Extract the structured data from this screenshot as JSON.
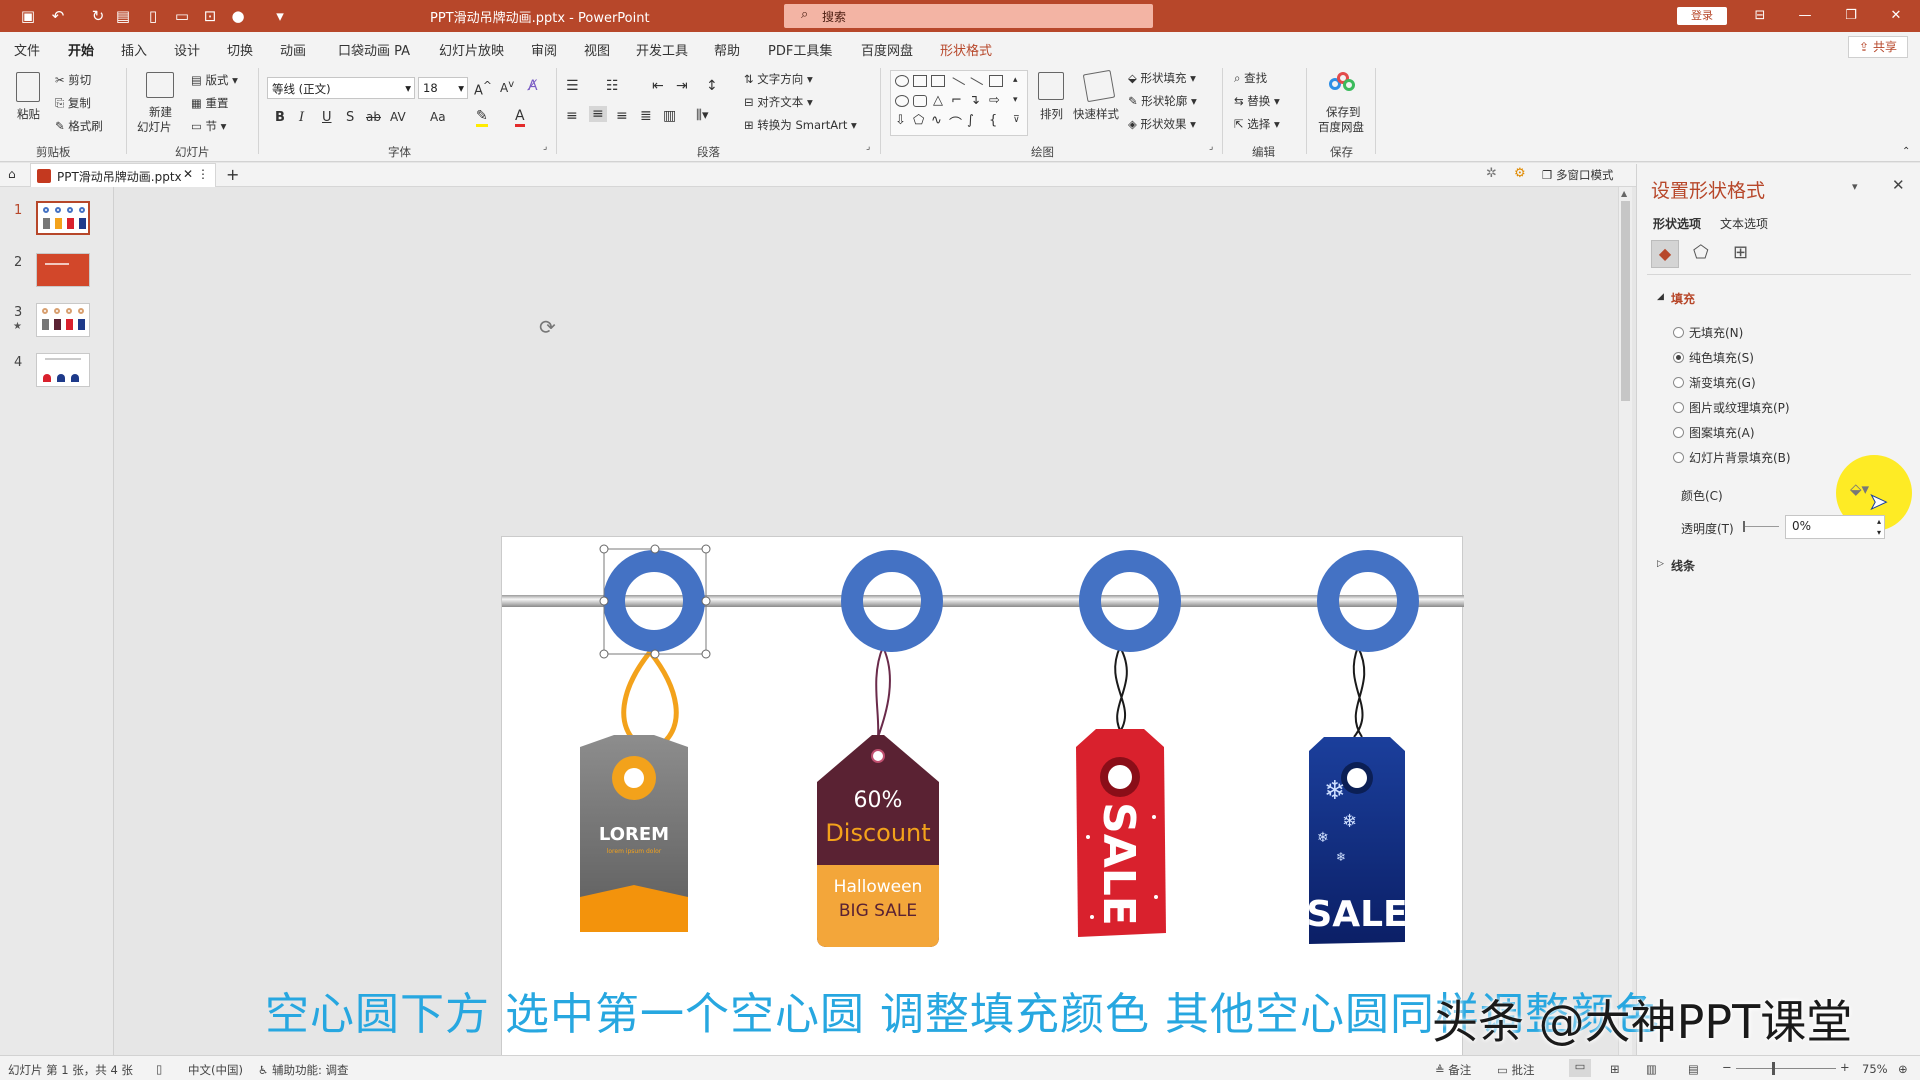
{
  "window": {
    "title": "PPT滑动吊牌动画.pptx - PowerPoint",
    "search_placeholder": "搜索",
    "login": "登录",
    "share": "共享"
  },
  "menu_tabs": [
    "文件",
    "开始",
    "插入",
    "设计",
    "切换",
    "动画",
    "口袋动画 PA",
    "幻灯片放映",
    "审阅",
    "视图",
    "开发工具",
    "帮助",
    "PDF工具集",
    "百度网盘",
    "形状格式"
  ],
  "active_tab": "开始",
  "ribbon": {
    "clipboard": {
      "paste": "粘贴",
      "cut": "剪切",
      "copy": "复制",
      "format_painter": "格式刷",
      "label": "剪贴板"
    },
    "slides": {
      "new_slide": "新建",
      "new_slide2": "幻灯片",
      "layout": "版式",
      "reset": "重置",
      "section": "节",
      "label": "幻灯片"
    },
    "font": {
      "name": "等线 (正文)",
      "size": "18",
      "label": "字体",
      "bold": "B",
      "italic": "I",
      "underline": "U",
      "shadow": "S",
      "strike": "ab",
      "spacing": "AV",
      "case": "Aa"
    },
    "paragraph": {
      "text_direction": "文字方向",
      "align_text": "对齐文本",
      "smartart": "转换为 SmartArt",
      "label": "段落"
    },
    "drawing": {
      "arrange": "排列",
      "quick_styles": "快速样式",
      "shape_fill": "形状填充",
      "shape_outline": "形状轮廓",
      "shape_effects": "形状效果",
      "label": "绘图"
    },
    "editing": {
      "find": "查找",
      "replace": "替换",
      "select": "选择",
      "label": "编辑"
    },
    "save": {
      "save_to": "保存到",
      "baidu": "百度网盘",
      "label": "保存"
    }
  },
  "doc_tab": {
    "name": "PPT滑动吊牌动画.pptx",
    "multiwindow": "多窗口模式"
  },
  "thumbnails": [
    {
      "num": "1",
      "selected": true
    },
    {
      "num": "2",
      "selected": false
    },
    {
      "num": "3",
      "selected": false
    },
    {
      "num": "4",
      "selected": false
    }
  ],
  "slide": {
    "tag1": {
      "title": "LOREM",
      "sub": "lorem ipsum dolor"
    },
    "tag2": {
      "line1": "60%",
      "line2": "Discount",
      "line3": "Halloween",
      "line4": "BIG SALE"
    },
    "tag3": {
      "text": "SALE"
    },
    "tag4": {
      "text": "SALE"
    }
  },
  "format_panel": {
    "title": "设置形状格式",
    "tabs": [
      "形状选项",
      "文本选项"
    ],
    "fill_header": "填充",
    "options": [
      {
        "label": "无填充(N)",
        "selected": false
      },
      {
        "label": "纯色填充(S)",
        "selected": true
      },
      {
        "label": "渐变填充(G)",
        "selected": false
      },
      {
        "label": "图片或纹理填充(P)",
        "selected": false
      },
      {
        "label": "图案填充(A)",
        "selected": false
      },
      {
        "label": "幻灯片背景填充(B)",
        "selected": false
      }
    ],
    "color_label": "颜色(C)",
    "transparency_label": "透明度(T)",
    "transparency_value": "0%",
    "line_header": "线条"
  },
  "status": {
    "slide_info": "幻灯片 第 1 张，共 4 张",
    "language": "中文(中国)",
    "accessibility": "辅助功能: 调查",
    "notes": "备注",
    "comments": "批注",
    "zoom": "75%"
  },
  "caption": "空心圆下方 选中第一个空心圆 调整填充颜色 其他空心圆同样调整颜色",
  "watermark": "头条 @大神PPT课堂",
  "colors": {
    "accent": "#b7472a",
    "ring": "#4472c4",
    "caption": "#27a7e0"
  }
}
